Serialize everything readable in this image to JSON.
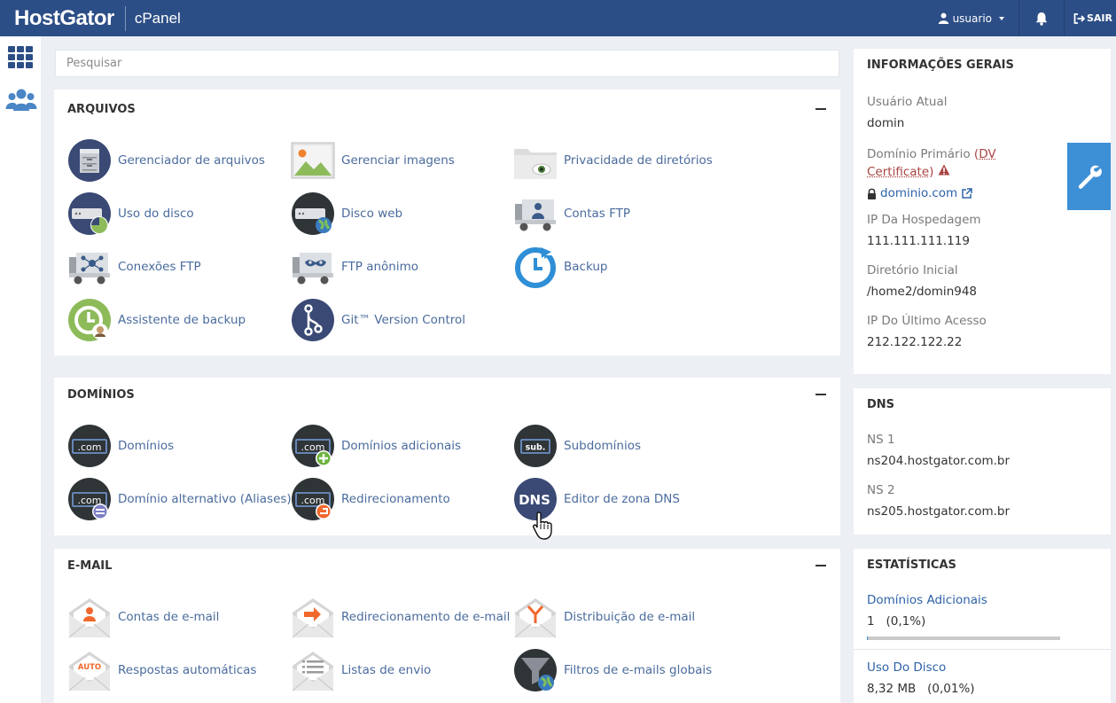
{
  "header": {
    "brand": "HostGator",
    "product": "cPanel",
    "user": "usuario",
    "logout": "SAIR"
  },
  "search": {
    "placeholder": "Pesquisar"
  },
  "sections": {
    "arquivos": {
      "title": "ARQUIVOS",
      "items": [
        {
          "label": "Gerenciador de arquivos",
          "icon": "file-manager-icon"
        },
        {
          "label": "Gerenciar imagens",
          "icon": "images-icon"
        },
        {
          "label": "Privacidade de diretórios",
          "icon": "directory-privacy-icon"
        },
        {
          "label": "Uso do disco",
          "icon": "disk-usage-icon"
        },
        {
          "label": "Disco web",
          "icon": "web-disk-icon"
        },
        {
          "label": "Contas FTP",
          "icon": "ftp-accounts-icon"
        },
        {
          "label": "Conexões FTP",
          "icon": "ftp-connections-icon"
        },
        {
          "label": "FTP anônimo",
          "icon": "anonymous-ftp-icon"
        },
        {
          "label": "Backup",
          "icon": "backup-icon"
        },
        {
          "label": "Assistente de backup",
          "icon": "backup-wizard-icon"
        },
        {
          "label": "Git™ Version Control",
          "icon": "git-icon"
        }
      ]
    },
    "dominios": {
      "title": "DOMÍNIOS",
      "items": [
        {
          "label": "Domínios",
          "icon": "domains-icon",
          "badge": ".com"
        },
        {
          "label": "Domínios adicionais",
          "icon": "addon-domains-icon",
          "badge": ".com"
        },
        {
          "label": "Subdomínios",
          "icon": "subdomains-icon",
          "badge": "sub."
        },
        {
          "label": "Domínio alternativo (Aliases)",
          "icon": "aliases-icon",
          "badge": ".com"
        },
        {
          "label": "Redirecionamento",
          "icon": "redirects-icon",
          "badge": ".com"
        },
        {
          "label": "Editor de zona DNS",
          "icon": "dns-zone-editor-icon",
          "badge": "DNS"
        }
      ]
    },
    "email": {
      "title": "E-MAIL",
      "items": [
        {
          "label": "Contas de e-mail",
          "icon": "email-accounts-icon"
        },
        {
          "label": "Redirecionamento de e-mail",
          "icon": "forwarders-icon"
        },
        {
          "label": "Distribuição de e-mail",
          "icon": "email-routing-icon"
        },
        {
          "label": "Respostas automáticas",
          "icon": "autoresponders-icon",
          "badge": "AUTO"
        },
        {
          "label": "Listas de envio",
          "icon": "mailing-lists-icon"
        },
        {
          "label": "Filtros de e-mails globais",
          "icon": "global-filters-icon"
        }
      ]
    }
  },
  "general_info": {
    "title": "INFORMAÇÕES GERAIS",
    "current_user_label": "Usuário Atual",
    "current_user": "domin",
    "primary_domain_label": "Domínio Primário",
    "primary_domain_cert_prefix": "(",
    "primary_domain_cert": "DV Certificate",
    "primary_domain_cert_suffix": ")",
    "primary_domain": "dominio.com",
    "hosting_ip_label": "IP Da Hospedagem",
    "hosting_ip": "111.111.111.119",
    "home_dir_label": "Diretório Inicial",
    "home_dir": "/home2/domin948",
    "last_ip_label": "IP Do Último Acesso",
    "last_ip": "212.122.122.22"
  },
  "dns": {
    "title": "DNS",
    "ns1_label": "NS 1",
    "ns1": "ns204.hostgator.com.br",
    "ns2_label": "NS 2",
    "ns2": "ns205.hostgator.com.br"
  },
  "stats": {
    "title": "ESTATÍSTICAS",
    "addon_label": "Domínios Adicionais",
    "addon_count": "1",
    "addon_pct": "(0,1%)",
    "addon_fraction": 0.001,
    "disk_label": "Uso Do Disco",
    "disk_value": "8,32 MB",
    "disk_pct": "(0,01%)"
  },
  "colors": {
    "header": "#2c4e86",
    "link": "#4a6b9d",
    "accent": "#3d8fd6",
    "icon_navy": "#3a4a75"
  }
}
